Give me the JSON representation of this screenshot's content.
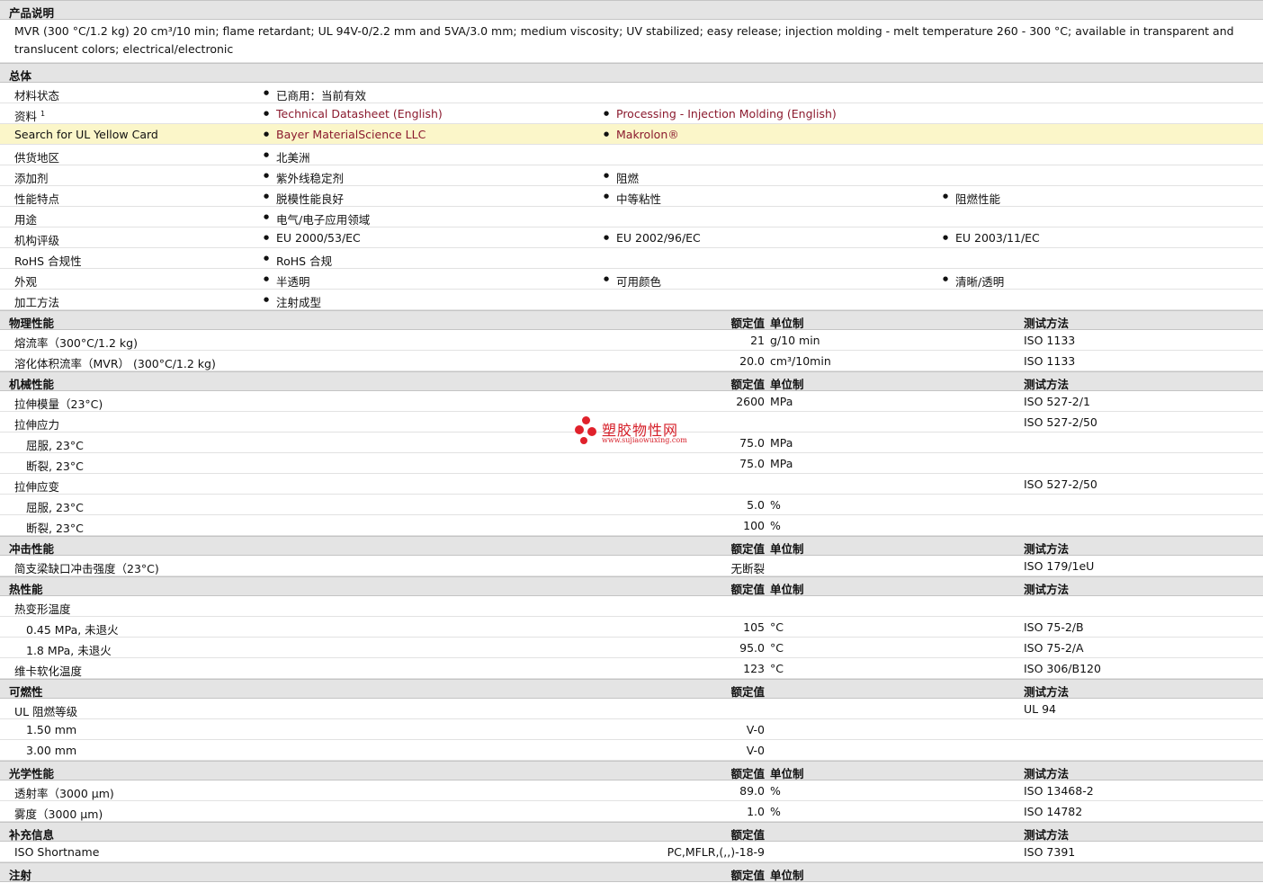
{
  "sections": {
    "desc_title": "产品说明",
    "desc_text": "MVR (300 °C/1.2 kg) 20 cm³/10 min; flame retardant; UL 94V-0/2.2 mm and 5VA/3.0 mm; medium viscosity; UV stabilized; easy release; injection molding - melt temperature 260 - 300 °C; available in transparent and translucent colors; electrical/electronic",
    "general": "总体",
    "physical": "物理性能",
    "mechanical": "机械性能",
    "impact": "冲击性能",
    "thermal": "热性能",
    "flammability": "可燃性",
    "optical": "光学性能",
    "additional": "补充信息",
    "injection": "注射"
  },
  "headers": {
    "nominal": "额定值",
    "unit": "单位制",
    "method": "测试方法"
  },
  "general": [
    {
      "label": "材料状态",
      "c1": "已商用：当前有效"
    },
    {
      "label": "资料",
      "sup": "1",
      "c1": "Technical Datasheet (English)",
      "c2": "Processing - Injection Molding (English)"
    },
    {
      "label": "Search for UL Yellow Card",
      "c1": "Bayer MaterialScience LLC",
      "c2": "Makrolon®"
    },
    {
      "label": "供货地区",
      "c1": "北美洲"
    },
    {
      "label": "添加剂",
      "c1": "紫外线稳定剂",
      "c2": "阻燃"
    },
    {
      "label": "性能特点",
      "c1": "脱模性能良好",
      "c2": "中等粘性",
      "c3": "阻燃性能"
    },
    {
      "label": "用途",
      "c1": "电气/电子应用领域"
    },
    {
      "label": "机构评级",
      "c1": "EU 2000/53/EC",
      "c2": "EU 2002/96/EC",
      "c3": "EU 2003/11/EC"
    },
    {
      "label": "RoHS 合规性",
      "c1": "RoHS 合规"
    },
    {
      "label": "外观",
      "c1": "半透明",
      "c2": "可用颜色",
      "c3": "清晰/透明"
    },
    {
      "label": "加工方法",
      "c1": "注射成型"
    }
  ],
  "physical": [
    {
      "label": "熔流率（300°C/1.2 kg)",
      "value": "21",
      "unit": "g/10 min",
      "method": "ISO 1133"
    },
    {
      "label": "溶化体积流率（MVR） (300°C/1.2 kg)",
      "value": "20.0",
      "unit": "cm³/10min",
      "method": "ISO 1133"
    }
  ],
  "mechanical": [
    {
      "label": "拉伸模量（23°C)",
      "value": "2600",
      "unit": "MPa",
      "method": "ISO 527-2/1"
    },
    {
      "label": "拉伸应力",
      "method": "ISO 527-2/50"
    },
    {
      "label": "屈服, 23°C",
      "value": "75.0",
      "unit": "MPa",
      "sub": true
    },
    {
      "label": "断裂, 23°C",
      "value": "75.0",
      "unit": "MPa",
      "sub": true
    },
    {
      "label": "拉伸应变",
      "method": "ISO 527-2/50"
    },
    {
      "label": "屈服, 23°C",
      "value": "5.0",
      "unit": "%",
      "sub": true
    },
    {
      "label": "断裂, 23°C",
      "value": "100",
      "unit": "%",
      "sub": true
    }
  ],
  "impact": [
    {
      "label": "简支梁缺口冲击强度（23°C)",
      "value": "无断裂",
      "method": "ISO 179/1eU"
    }
  ],
  "thermal": [
    {
      "label": "热变形温度"
    },
    {
      "label": "0.45 MPa, 未退火",
      "value": "105",
      "unit": "°C",
      "method": "ISO 75-2/B",
      "sub": true
    },
    {
      "label": "1.8 MPa, 未退火",
      "value": "95.0",
      "unit": "°C",
      "method": "ISO 75-2/A",
      "sub": true
    },
    {
      "label": "维卡软化温度",
      "value": "123",
      "unit": "°C",
      "method": "ISO 306/B120"
    }
  ],
  "flammability": [
    {
      "label": "UL 阻燃等级",
      "method": "UL 94"
    },
    {
      "label": "1.50 mm",
      "value": "V-0",
      "sub": true
    },
    {
      "label": "3.00 mm",
      "value": "V-0",
      "sub": true
    }
  ],
  "optical": [
    {
      "label": "透射率（3000 µm)",
      "value": "89.0",
      "unit": "%",
      "method": "ISO 13468-2"
    },
    {
      "label": "雾度（3000 µm)",
      "value": "1.0",
      "unit": "%",
      "method": "ISO 14782"
    }
  ],
  "additional": [
    {
      "label": "ISO Shortname",
      "value": "PC,MFLR,(,,)-18-9",
      "method": "ISO 7391"
    }
  ],
  "watermark": {
    "name": "塑胶物性网",
    "url": "www.sujiaowuxing.com"
  },
  "colors": {
    "link": "#8b1a2e",
    "highlight": "#fbf6c9",
    "watermark": "#e0212b"
  }
}
